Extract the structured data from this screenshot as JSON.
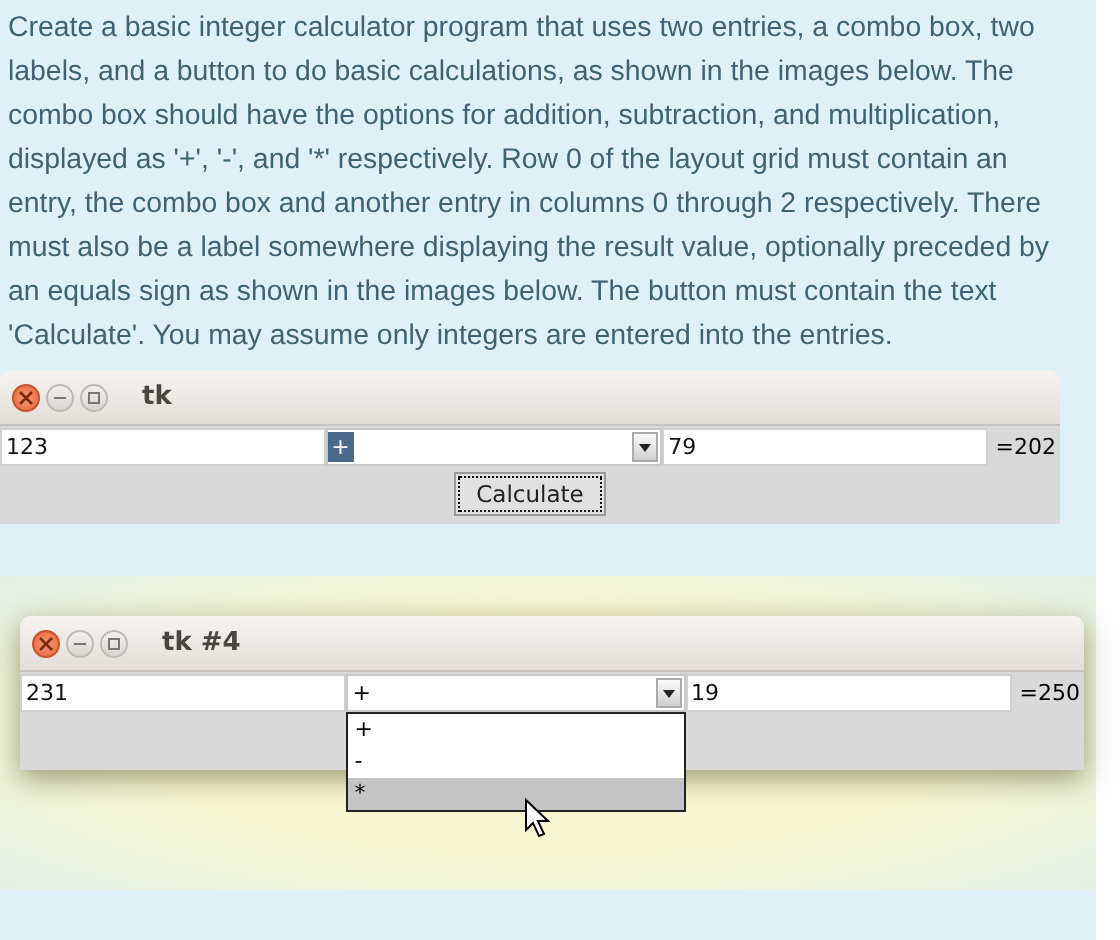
{
  "instructions": "Create a basic integer calculator program that uses two entries, a combo box, two labels, and a button to do basic calculations, as shown in the images below. The combo box should have the options for addition, subtraction, and multiplication, displayed as '+', '-', and '*' respectively. Row 0 of the layout grid must contain an entry, the combo box and another entry in columns 0 through 2 respectively. There must also be a label somewhere displaying the result value, optionally preceded by an equals sign as shown in the images below. The button must contain the text 'Calculate'. You may assume only integers are entered into the entries.",
  "windows": [
    {
      "title": "tk",
      "entry_1": "123",
      "combo": {
        "value": "+",
        "text_selected": true,
        "open": false
      },
      "entry_2": "79",
      "result": "=202",
      "button": {
        "label": "Calculate",
        "focused": true
      }
    },
    {
      "title": "tk #4",
      "entry_1": "231",
      "combo": {
        "value": "+",
        "text_selected": false,
        "open": true,
        "options": [
          {
            "label": "+",
            "highlighted": false
          },
          {
            "label": "-",
            "highlighted": false
          },
          {
            "label": "*",
            "highlighted": true
          }
        ]
      },
      "entry_2": "19",
      "result": "=250"
    }
  ]
}
